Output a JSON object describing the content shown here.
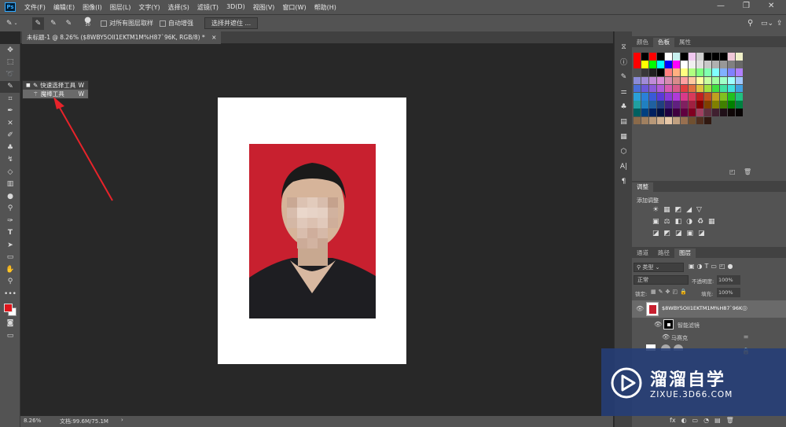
{
  "app": {
    "logo": "Ps"
  },
  "menu": [
    "文件(F)",
    "编辑(E)",
    "图像(I)",
    "图层(L)",
    "文字(Y)",
    "选择(S)",
    "滤镜(T)",
    "3D(D)",
    "视图(V)",
    "窗口(W)",
    "帮助(H)"
  ],
  "window_controls": {
    "minimize": "—",
    "restore": "❐",
    "close": "✕"
  },
  "options_bar": {
    "brush_size": "30",
    "sample_all_layers": "对所有图层取样",
    "auto_enhance": "自动增强",
    "select_and_mask": "选择并遮住 ..."
  },
  "document_tab": {
    "title": "未标题-1 @ 8.26% ($8WBY5OII1EKTM1M%H87`96K, RGB/8) *",
    "close": "×"
  },
  "tool_flyout": {
    "items": [
      {
        "label": "快速选择工具",
        "shortcut": "W"
      },
      {
        "label": "魔棒工具",
        "shortcut": "W"
      }
    ]
  },
  "status": {
    "zoom": "8.26%",
    "doc_info": "文档:99.6M/75.1M"
  },
  "color_panel": {
    "tabs": [
      "颜色",
      "色板",
      "属性"
    ]
  },
  "adjustments_panel": {
    "tab": "调整",
    "add_label": "添加调整"
  },
  "layers_panel": {
    "tabs": [
      "通道",
      "路径",
      "图层"
    ],
    "filter_kind": "类型",
    "blend_mode": "正常",
    "opacity_label": "不透明度:",
    "opacity_value": "100%",
    "lock_label": "锁定:",
    "fill_label": "填充:",
    "fill_value": "100%",
    "layer_name": "$8WBY5OII1EKTM1M%H87`96K",
    "smart_filters": "智能滤镜",
    "filter_name": "马赛克"
  },
  "watermark": {
    "brand": "溜溜自学",
    "url": "ZIXUE.3D66.COM"
  },
  "colors": {
    "accent": "#31a8ff",
    "foreground": "#e0151b",
    "background": "#ffffff",
    "photo_bg": "#c8202f",
    "watermark": "#243e78"
  },
  "swatch_rows": [
    [
      "#ff0000",
      "#000000",
      "#ff0000",
      "#000000",
      "#ffffff",
      "#c8f0f0",
      "#000000",
      "#f0c8f0",
      "#d0d0d0",
      "#000000",
      "#000000",
      "#000000",
      "#f0c8d8",
      "#f0f0c8"
    ],
    [
      "#ff0000",
      "#ffff00",
      "#00ff00",
      "#00ffff",
      "#0000ff",
      "#ff00ff",
      "#ffffff",
      "#f0f0f0",
      "#e0e0e0",
      "#c8c8c8",
      "#b0b0b0",
      "#989898",
      "#808080",
      "#686868"
    ],
    [
      "#505050",
      "#383838",
      "#202020",
      "#000000",
      "#ff8080",
      "#ffb080",
      "#ffff80",
      "#b0ff80",
      "#80ff80",
      "#80ffb0",
      "#80ffff",
      "#80b0ff",
      "#8080ff",
      "#b080ff"
    ],
    [
      "#8b8bd8",
      "#a08bd8",
      "#c08bd8",
      "#d88bd8",
      "#d88bb0",
      "#d88b8b",
      "#ffa0a0",
      "#ffc8a0",
      "#ffffa0",
      "#c8ffa0",
      "#a0ffa0",
      "#a0ffc8",
      "#a0ffff",
      "#a0c8ff"
    ],
    [
      "#4a6ed8",
      "#6a5ad8",
      "#8a5ad8",
      "#b05ad8",
      "#d85ab0",
      "#d85a8a",
      "#e04040",
      "#e07040",
      "#e0c040",
      "#a0e040",
      "#40e040",
      "#40e0a0",
      "#40e0e0",
      "#40a0e0"
    ],
    [
      "#2aa0d8",
      "#2a80d8",
      "#3a5ad8",
      "#5a3ad8",
      "#8a3ad8",
      "#b03ad8",
      "#d83a8a",
      "#d83a5a",
      "#c02020",
      "#c05020",
      "#c0a020",
      "#80c020",
      "#20c020",
      "#20c080"
    ],
    [
      "#20a0a0",
      "#2080c0",
      "#2060a0",
      "#204080",
      "#402080",
      "#602080",
      "#802060",
      "#a02040",
      "#800000",
      "#804000",
      "#808000",
      "#408000",
      "#008000",
      "#008040"
    ],
    [
      "#006060",
      "#004080",
      "#002060",
      "#001040",
      "#200040",
      "#400040",
      "#600040",
      "#800020",
      "#a04060",
      "#603040",
      "#402030",
      "#201018",
      "#100808",
      "#080404"
    ],
    [
      "#8a6a4a",
      "#a08060",
      "#b89878",
      "#d0b090",
      "#e8c8a8",
      "#c0a080",
      "#987050",
      "#705030",
      "#503020",
      "#301810",
      "",
      "",
      "",
      ""
    ]
  ],
  "adj_icons": [
    "☀",
    "▦",
    "◩",
    "◢",
    "▽",
    "▣",
    "⚖",
    "◧",
    "◑",
    "♻",
    "▦",
    "◪",
    "◩",
    "◪",
    "▣",
    "◪"
  ],
  "layer_icons": [
    "fx",
    "◐",
    "▭",
    "◔",
    "▤",
    "🗑"
  ]
}
